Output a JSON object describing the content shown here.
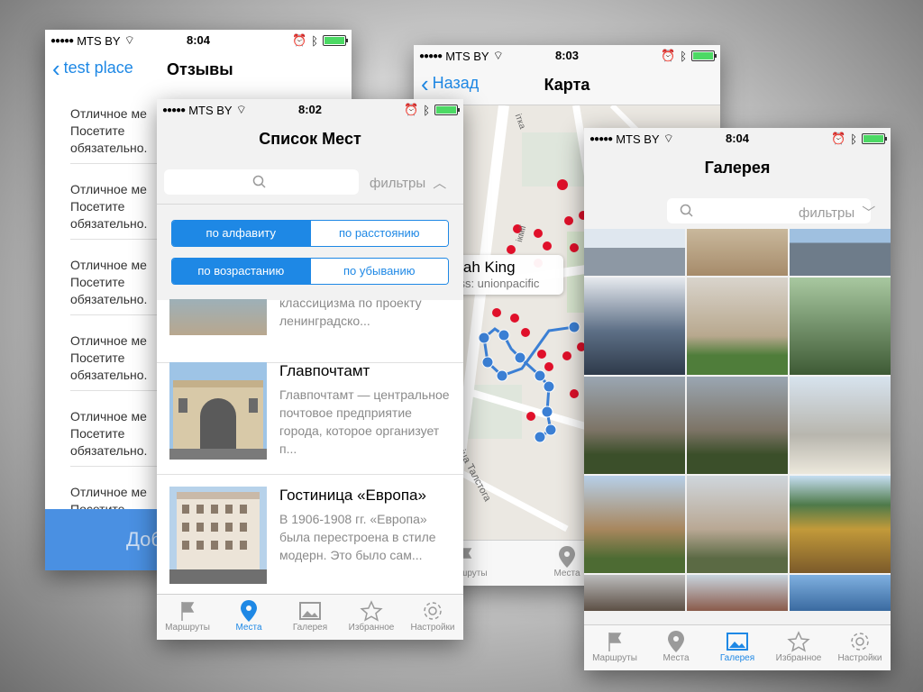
{
  "status": {
    "carrier": "MTS BY",
    "time_reviews": "8:04",
    "time_list": "8:02",
    "time_map": "8:03",
    "time_gallery": "8:04"
  },
  "reviews_screen": {
    "back_label": "test place",
    "title": "Отзывы",
    "reviews": [
      {
        "line1": "Отличное ме",
        "line2": "Посетите",
        "line3": "обязательно."
      },
      {
        "line1": "Отличное ме",
        "line2": "Посетите",
        "line3": "обязательно."
      },
      {
        "line1": "Отличное ме",
        "line2": "Посетите",
        "line3": "обязательно."
      },
      {
        "line1": "Отличное ме",
        "line2": "Посетите",
        "line3": "обязательно."
      },
      {
        "line1": "Отличное ме",
        "line2": "Посетите",
        "line3": "обязательно."
      },
      {
        "line1": "Отличное ме",
        "line2": "Посетите",
        "line3": ""
      }
    ],
    "add_button": "Доб"
  },
  "list_screen": {
    "title": "Список Мест",
    "filters_label": "фильтры",
    "sort_alpha": "по алфавиту",
    "sort_distance": "по расстоянию",
    "order_asc": "по возрастанию",
    "order_desc": "по убыванию",
    "items": [
      {
        "title": "",
        "desc": "классицизма по проекту ленинградско..."
      },
      {
        "title": "Главпочтамт",
        "desc": "Главпочтамт — центральное почтовое предприятие города, которое организует п..."
      },
      {
        "title": "Гостиница «Европа»",
        "desc": "В 1906-1908 гг. «Европа» была перестроена в стиле модерн. Это было сам..."
      }
    ]
  },
  "map_screen": {
    "back_label": "Назад",
    "title": "Карта",
    "callout_title": "odah King",
    "callout_sub": "pass: unionpacific",
    "street1": "вуліца Талстога",
    "street2": "ітка",
    "street3": "ікмії"
  },
  "gallery_screen": {
    "title": "Галерея",
    "filters_label": "фильтры"
  },
  "tabs": {
    "routes": "Маршруты",
    "places": "Места",
    "gallery": "Галерея",
    "favorites": "Избранное",
    "settings": "Настройки"
  },
  "colors": {
    "accent": "#1e88e5",
    "battery": "#4cd964",
    "pin": "#e0102a"
  }
}
